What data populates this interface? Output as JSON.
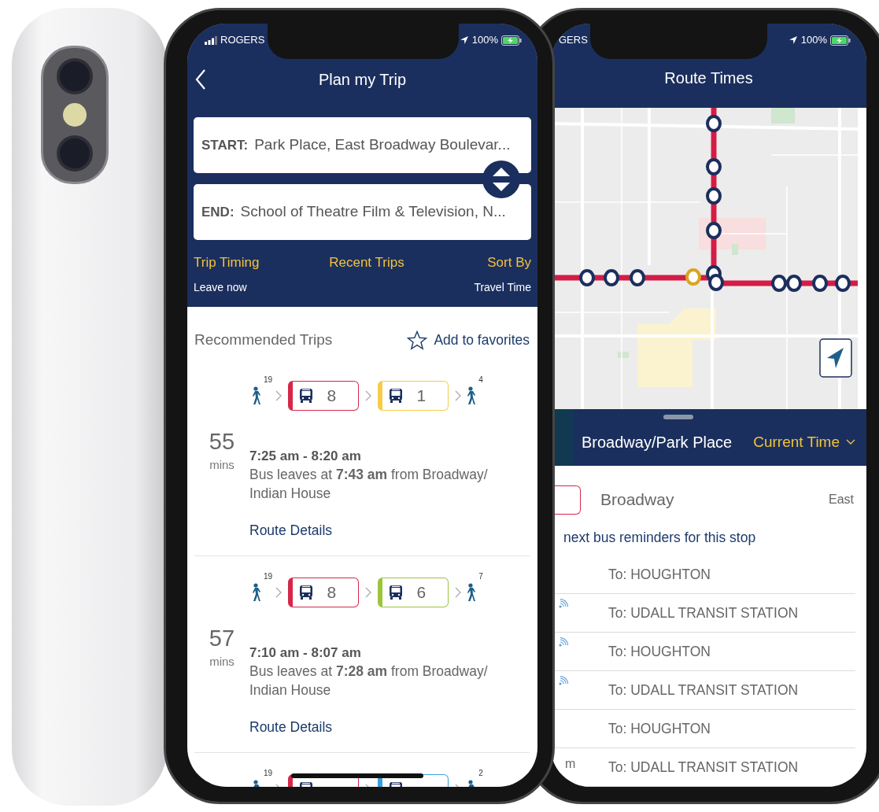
{
  "plan_screen": {
    "status_bar": {
      "carrier": "ROGERS",
      "battery": "100%"
    },
    "title": "Plan my Trip",
    "start": {
      "label": "START:",
      "value": "Park Place, East Broadway Boulevar..."
    },
    "end": {
      "label": "END:",
      "value": "School of Theatre Film & Television, N..."
    },
    "options": [
      {
        "label": "Trip Timing",
        "value": "Leave now"
      },
      {
        "label": "Recent Trips"
      },
      {
        "label": "Sort By",
        "value": "Travel Time"
      }
    ],
    "section_title": "Recommended Trips",
    "favorite_label": "Add to favorites",
    "trips": [
      {
        "duration": "55",
        "unit": "mins",
        "walk_before": "19",
        "legs": [
          {
            "route": "8",
            "color": "#d6264a"
          },
          {
            "route": "1",
            "color": "#f5cd4a"
          }
        ],
        "walk_after": "4",
        "time_range": "7:25 am - 8:20 am",
        "departure": "Bus leaves at **7:43 am** from Broadway/ Indian House",
        "link": "Route Details"
      },
      {
        "duration": "57",
        "unit": "mins",
        "walk_before": "19",
        "legs": [
          {
            "route": "8",
            "color": "#d6264a"
          },
          {
            "route": "6",
            "color": "#9cc53a"
          }
        ],
        "walk_after": "7",
        "time_range": "7:10 am - 8:07 am",
        "departure": "Bus leaves at **7:28 am** from Broadway/ Indian House",
        "link": "Route Details"
      },
      {
        "walk_before": "19",
        "legs": [
          {
            "color": "#d6264a"
          },
          {
            "color": "#3aa0dc"
          }
        ],
        "walk_after": "2"
      }
    ]
  },
  "route_screen": {
    "status_bar": {
      "carrier": "GERS",
      "battery": "100%"
    },
    "title": "Route Times",
    "stop_name": "Broadway/Park Place",
    "time_filter": "Current Time",
    "route": {
      "name": "Broadway",
      "direction": "East",
      "color": "#d6264a"
    },
    "reminder_link": "next bus reminders for this stop",
    "departures": [
      {
        "destination": "To: HOUGHTON",
        "realtime": false
      },
      {
        "destination": "To: UDALL TRANSIT STATION",
        "realtime": true
      },
      {
        "destination": "To: HOUGHTON",
        "realtime": true
      },
      {
        "destination": "To: UDALL TRANSIT STATION",
        "realtime": true
      },
      {
        "destination": "To: HOUGHTON",
        "realtime": false
      },
      {
        "time": "m",
        "destination": "To: UDALL TRANSIT STATION",
        "realtime": false
      }
    ]
  }
}
